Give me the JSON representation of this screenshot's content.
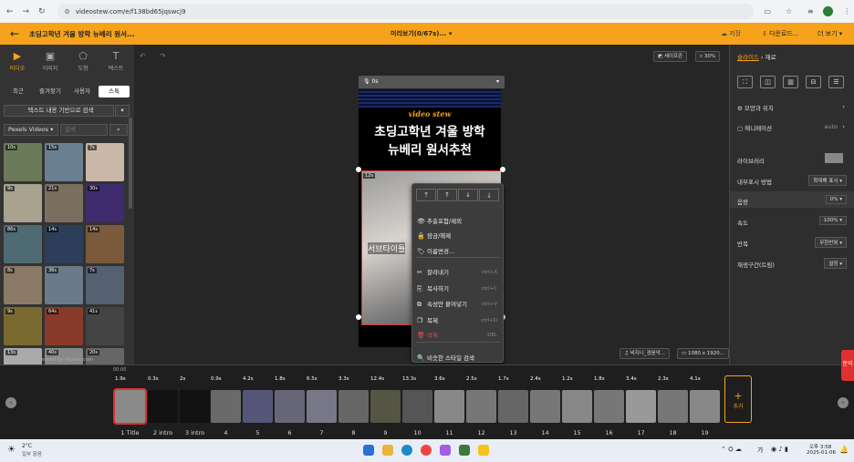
{
  "browser": {
    "url": "videostew.com/e/f138bd65jqswcj9"
  },
  "topbar": {
    "title": "초딩고학년 겨울 방학 뉴베리 원서...",
    "preview": "미리보기(0/67s)...",
    "save": "저장",
    "download": "다운로드...",
    "more": "더 보기"
  },
  "leftpanel": {
    "media_tabs": [
      "비디오",
      "이미지",
      "도형",
      "텍스트"
    ],
    "sub_tabs": [
      "최근",
      "즐겨찾기",
      "사용자",
      "스톡"
    ],
    "search_dropdown": "텍스트 내용 기반으로 검색",
    "source": "Pexels Videos",
    "search_placeholder": "검색",
    "powered": "Powered by Pexels.com",
    "thumbs": [
      {
        "d": "10s",
        "c": "#6b7a58"
      },
      {
        "d": "15s",
        "c": "#6a7f90"
      },
      {
        "d": "7s",
        "c": "#c9b8a8"
      },
      {
        "d": "9s",
        "c": "#a8a28e"
      },
      {
        "d": "21s",
        "c": "#7a6f5e"
      },
      {
        "d": "30s",
        "c": "#3e2b6e"
      },
      {
        "d": "86s",
        "c": "#4e6a72"
      },
      {
        "d": "14s",
        "c": "#2c3e5a"
      },
      {
        "d": "14s",
        "c": "#7a5a3a"
      },
      {
        "d": "8s",
        "c": "#8a7a66"
      },
      {
        "d": "36s",
        "c": "#6a7a8a"
      },
      {
        "d": "7s",
        "c": "#556070"
      },
      {
        "d": "9s",
        "c": "#7a6a30"
      },
      {
        "d": "64s",
        "c": "#8a3a2a"
      },
      {
        "d": "41s",
        "c": "#444"
      },
      {
        "d": "13s",
        "c": "#aaa"
      },
      {
        "d": "40s",
        "c": "#888"
      },
      {
        "d": "20s",
        "c": "#666"
      }
    ]
  },
  "workspace": {
    "mic_label": "0s",
    "safezone": "세이프존",
    "zoom": "30%",
    "logo": "video stew",
    "heading1": "초딩고학년 겨울 방학",
    "heading2": "뉴베리 원서추천",
    "clip_badge": "12s",
    "subtitle": "서브타이틀",
    "music": "비지니_경음악...",
    "resolution": "1080 x 1920..."
  },
  "context_menu": {
    "items": [
      {
        "icon": "👁",
        "label": "추출포함/제외",
        "sc": ""
      },
      {
        "icon": "🔒",
        "label": "잠금/해제",
        "sc": ""
      },
      {
        "icon": "🏷",
        "label": "이름변경...",
        "sc": ""
      },
      {
        "icon": "✂",
        "label": "잘라내기",
        "sc": "ctrl+X"
      },
      {
        "icon": "⎘",
        "label": "복사하기",
        "sc": "ctrl+C"
      },
      {
        "icon": "⧉",
        "label": "속성만 붙여넣기",
        "sc": "ctrl+V"
      },
      {
        "icon": "❐",
        "label": "복제",
        "sc": "ctrl+D"
      },
      {
        "icon": "🗑",
        "label": "삭제",
        "sc": "DEL"
      },
      {
        "icon": "🔍",
        "label": "비슷한 스타일 검색",
        "sc": ""
      }
    ]
  },
  "rightpanel": {
    "breadcrumb1": "슬라이드",
    "breadcrumb2": "재료",
    "shape_pos": "모양과 위치",
    "animation": "애니메이션",
    "animation_value": "auto",
    "library": "라이브러리",
    "display": "내부표시 방법",
    "display_value": "확대해 표시",
    "volume": "음량",
    "volume_value": "0%",
    "speed": "속도",
    "speed_value": "100%",
    "repeat": "반복",
    "repeat_value": "무한반복",
    "trim": "재생구간(트림)",
    "trim_value": "설정"
  },
  "timeline": {
    "time": "00:00",
    "add": "추가",
    "side": "문의",
    "clips": [
      {
        "d": "1.9s",
        "l": "1 Title",
        "c": "#8a8a8a"
      },
      {
        "d": "0.3s",
        "l": "2 intro",
        "c": "#111"
      },
      {
        "d": "2s",
        "l": "3 intro",
        "c": "#111"
      },
      {
        "d": "0.9s",
        "l": "4",
        "c": "#6a6a6a"
      },
      {
        "d": "4.2s",
        "l": "5",
        "c": "#557"
      },
      {
        "d": "1.8s",
        "l": "6",
        "c": "#667"
      },
      {
        "d": "6.5s",
        "l": "7",
        "c": "#778"
      },
      {
        "d": "3.3s",
        "l": "8",
        "c": "#666"
      },
      {
        "d": "12.4s",
        "l": "9",
        "c": "#554"
      },
      {
        "d": "13.3s",
        "l": "10",
        "c": "#555"
      },
      {
        "d": "3.6s",
        "l": "11",
        "c": "#888"
      },
      {
        "d": "2.5s",
        "l": "12",
        "c": "#777"
      },
      {
        "d": "1.7s",
        "l": "13",
        "c": "#666"
      },
      {
        "d": "2.4s",
        "l": "14",
        "c": "#777"
      },
      {
        "d": "1.2s",
        "l": "15",
        "c": "#888"
      },
      {
        "d": "1.8s",
        "l": "16",
        "c": "#777"
      },
      {
        "d": "3.4s",
        "l": "17",
        "c": "#999"
      },
      {
        "d": "2.3s",
        "l": "18",
        "c": "#777"
      },
      {
        "d": "4.1s",
        "l": "19",
        "c": "#888"
      }
    ]
  },
  "taskbar": {
    "weather": "2°C",
    "weather_desc": "일부 맑음",
    "time": "오후 3:58",
    "date": "2025-01-06",
    "lang": "가"
  }
}
